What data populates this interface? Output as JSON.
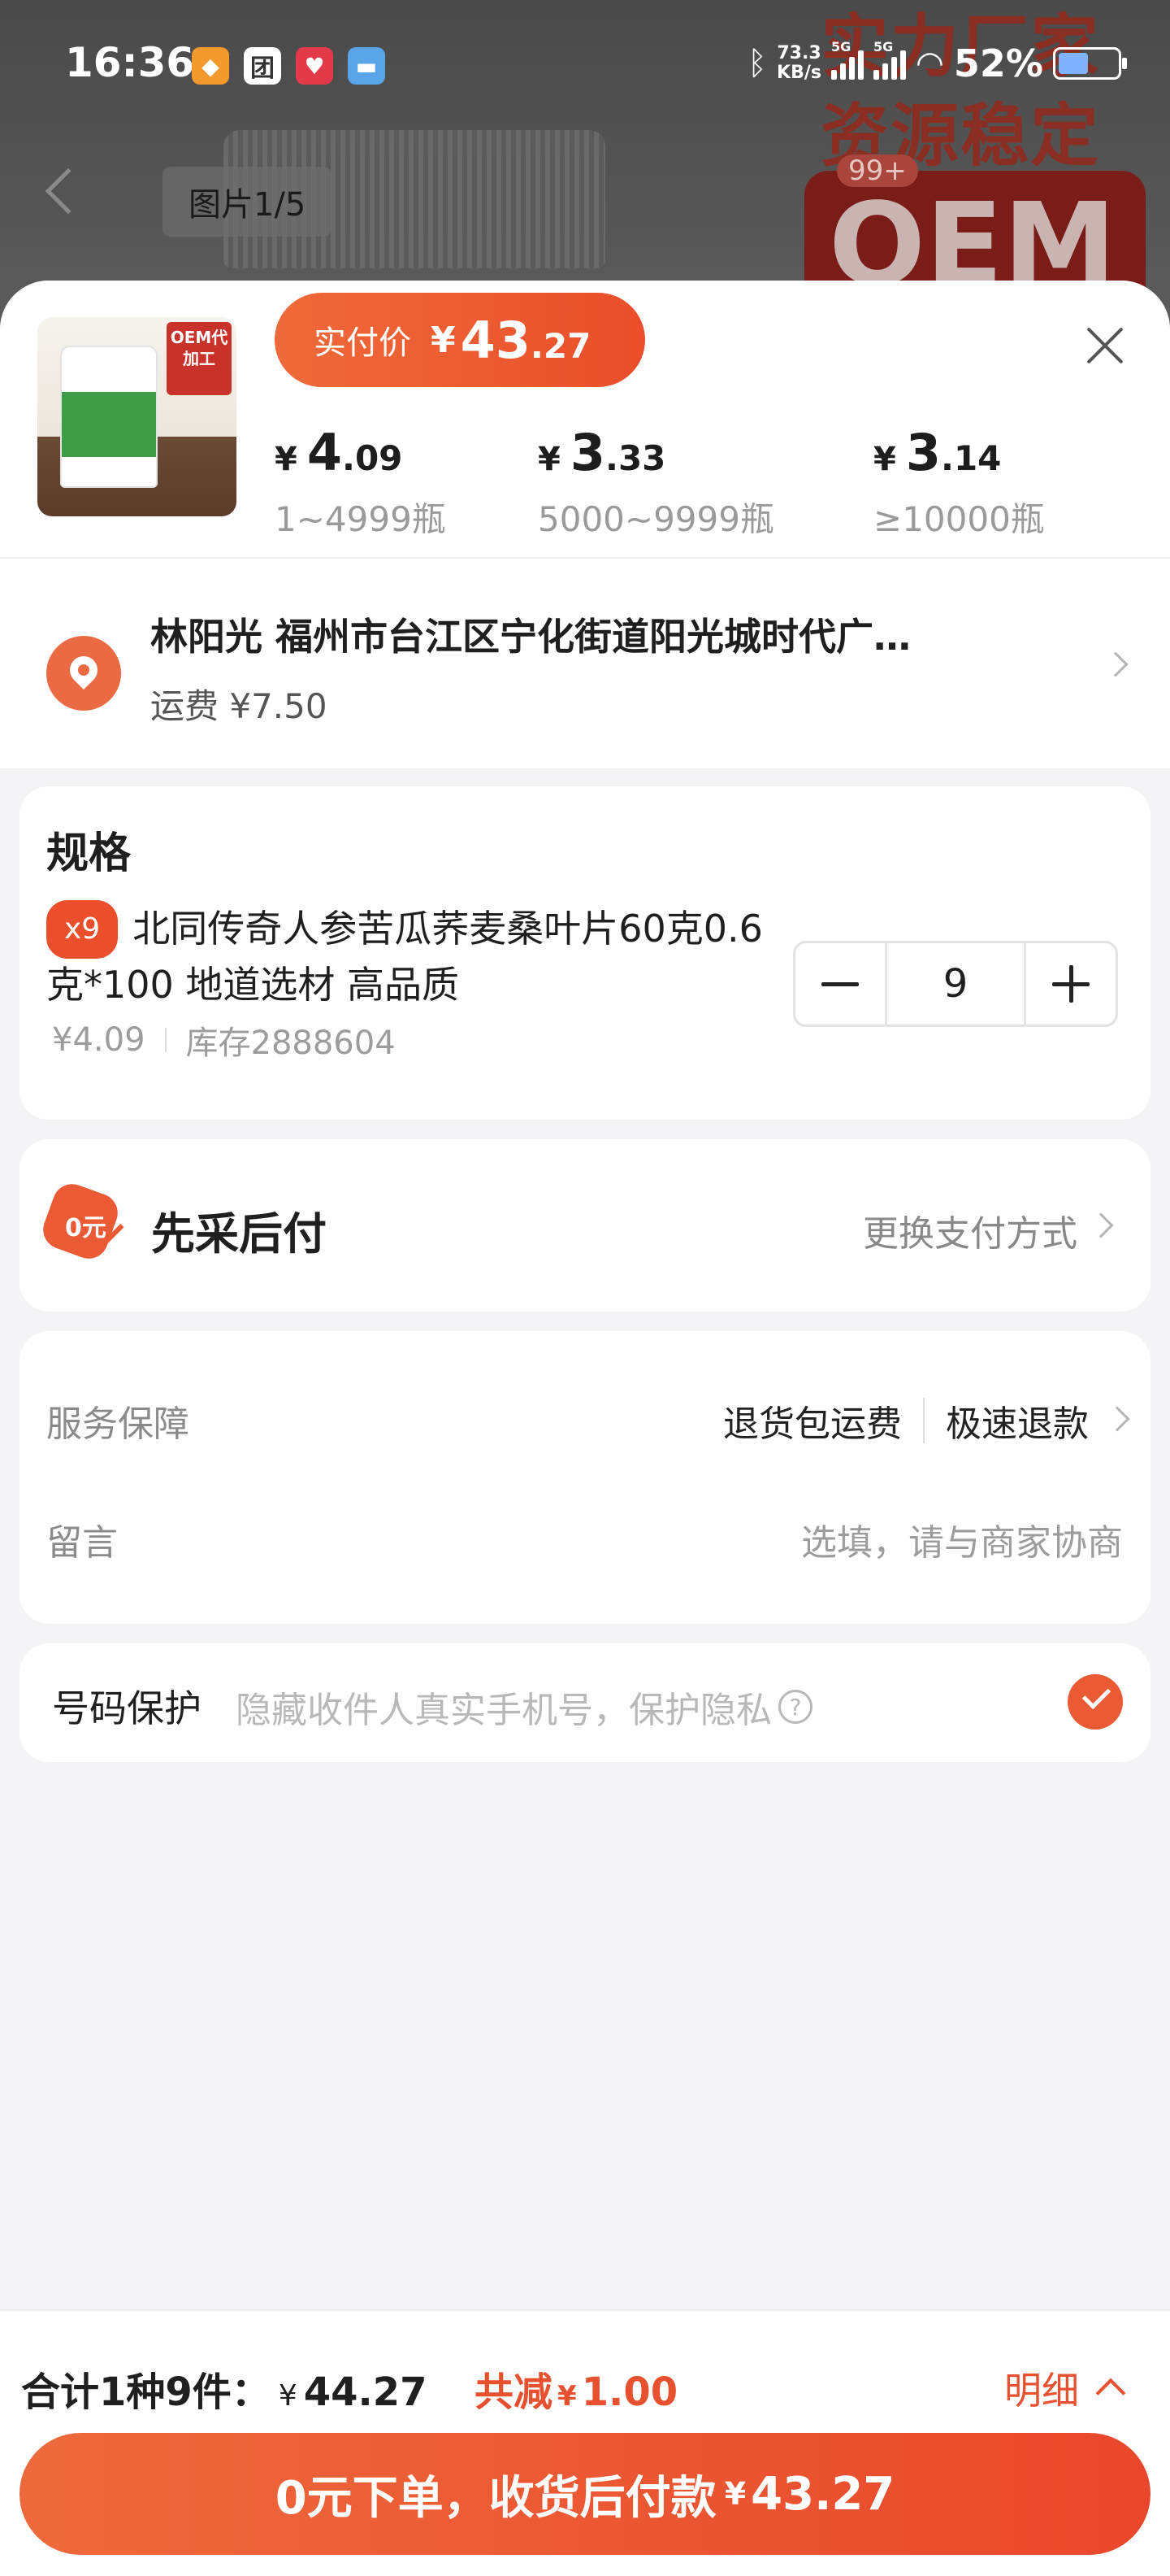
{
  "status_bar": {
    "time": "16:36",
    "net_speed_value": "73.3",
    "net_speed_unit": "KB/s",
    "signal_tag_1": "5G",
    "signal_tag_2": "5G",
    "battery": "52%",
    "battery_level": 0.52,
    "app_icons": [
      "团"
    ]
  },
  "gallery": {
    "counter": "图片1/5",
    "cart_badge": "99+",
    "promo_line_1": "实力厂家",
    "promo_line_2": "资源稳定",
    "promo_oem": "OEM"
  },
  "product": {
    "thumb_oem": "OEM代加工",
    "actual_price_label": "实付价",
    "actual_price_symbol": "¥",
    "actual_price_int": "43",
    "actual_price_dec": ".27",
    "tiers": [
      {
        "symbol": "¥",
        "int": "4",
        "dec": ".09",
        "range": "1~4999瓶"
      },
      {
        "symbol": "¥",
        "int": "3",
        "dec": ".33",
        "range": "5000~9999瓶"
      },
      {
        "symbol": "¥",
        "int": "3",
        "dec": ".14",
        "range": "≥10000瓶"
      }
    ]
  },
  "address": {
    "title": "林阳光 福州市台江区宁化街道阳光城时代广…",
    "shipping": "运费 ¥7.50"
  },
  "spec": {
    "title": "规格",
    "qty_badge": "x9",
    "name": "北同传奇人参苦瓜荞麦桑叶片60克0.6克*100 地道选材 高品质",
    "unit_price": "¥4.09",
    "stock": "库存2888604",
    "quantity": "9"
  },
  "payment": {
    "icon_text": "0元",
    "title": "先采后付",
    "change_label": "更换支付方式"
  },
  "service": {
    "label": "服务保障",
    "items": [
      "退货包运费",
      "极速退款"
    ],
    "note_label": "留言",
    "note_placeholder": "选填，请与商家协商"
  },
  "number_protect": {
    "label": "号码保护",
    "desc": "隐藏收件人真实手机号，保护隐私",
    "qmark": "?",
    "checked": true
  },
  "footer": {
    "total_label": "合计1种9件：",
    "total_symbol": "¥",
    "total_amount": "44.27",
    "reduce_label": "共减",
    "reduce_symbol": "¥",
    "reduce_amount": "1.00",
    "detail_label": "明细",
    "cta_label": "0元下单，收货后付款",
    "cta_symbol": "¥",
    "cta_amount": "43.27"
  },
  "colors": {
    "accent": "#ea5a35",
    "accent_dark": "#e9472b",
    "text_muted": "#9c9c9c"
  }
}
